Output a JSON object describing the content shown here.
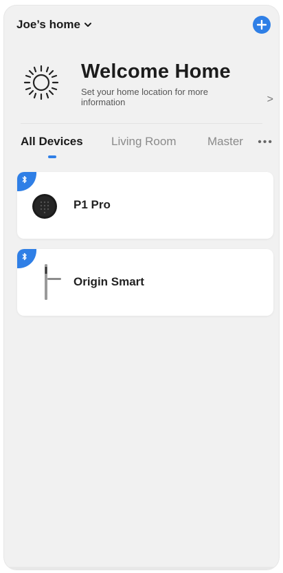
{
  "header": {
    "home_name": "Joe’s home",
    "add_icon": "plus-circle-icon"
  },
  "welcome": {
    "title": "Welcome Home",
    "subtitle": "Set your home location for more information",
    "arrow": ">",
    "icon": "sun-icon"
  },
  "tabs": {
    "items": [
      {
        "label": "All Devices",
        "active": true
      },
      {
        "label": "Living Room",
        "active": false
      },
      {
        "label": "Master",
        "active": false
      }
    ],
    "more": "•••"
  },
  "devices": [
    {
      "name": "P1 Pro",
      "connection": "bluetooth-icon",
      "thumbnail": "keypad-lock-icon"
    },
    {
      "name": "Origin Smart",
      "connection": "bluetooth-icon",
      "thumbnail": "handle-lock-icon"
    }
  ],
  "colors": {
    "accent": "#2f7fe6",
    "background": "#f1f1f1",
    "card": "#ffffff"
  }
}
